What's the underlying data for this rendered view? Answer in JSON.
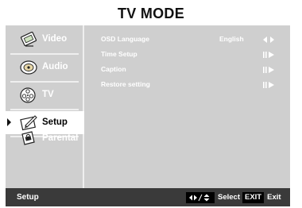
{
  "page": {
    "title": "TV MODE"
  },
  "sidebar": {
    "items": [
      {
        "label": "Video",
        "icon": "video-icon"
      },
      {
        "label": "Audio",
        "icon": "audio-icon"
      },
      {
        "label": "TV",
        "icon": "tv-reel-icon"
      },
      {
        "label": "Setup",
        "icon": "setup-icon",
        "active": true
      },
      {
        "label": "Parental",
        "icon": "parental-icon"
      }
    ]
  },
  "menu": {
    "rows": [
      {
        "label": "OSD Language",
        "value": "English",
        "control": "left-right-arrows-icon"
      },
      {
        "label": "Time Setup",
        "value": "",
        "control": "enter-arrow-icon"
      },
      {
        "label": "Caption",
        "value": "",
        "control": "enter-arrow-icon"
      },
      {
        "label": "Restore setting",
        "value": "",
        "control": "enter-arrow-icon"
      }
    ]
  },
  "status": {
    "breadcrumb": "Setup",
    "select_label": "Select",
    "exit_key": "EXIT",
    "exit_label": "Exit"
  },
  "colors": {
    "panel": "#cfcfcf",
    "status_bar": "#3a3a3a",
    "active_item": "#ffffff"
  }
}
